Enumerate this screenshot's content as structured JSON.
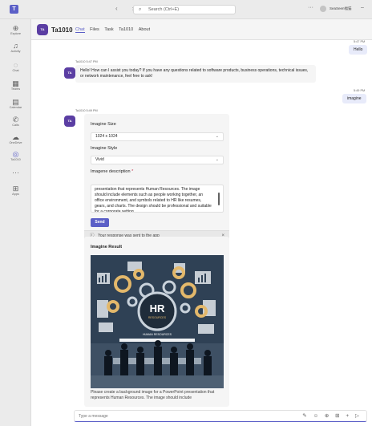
{
  "titlebar": {
    "logo": "T",
    "nav": "‹ ›",
    "search_placeholder": "Search (Ctrl+E)",
    "more": "···",
    "user": "SeaSeen福猫"
  },
  "rail": [
    {
      "label": "Explore",
      "glyph": "⊕"
    },
    {
      "label": "Activity",
      "glyph": "🔔"
    },
    {
      "label": "Chat",
      "glyph": "💬"
    },
    {
      "label": "Teams",
      "glyph": "▦"
    },
    {
      "label": "Calendar",
      "glyph": "▤"
    },
    {
      "label": "Calls",
      "glyph": "✆"
    },
    {
      "label": "OneDrive",
      "glyph": "☁"
    },
    {
      "label": "Ta1010",
      "glyph": "◎"
    },
    {
      "label": "",
      "glyph": "···"
    },
    {
      "label": "Apps",
      "glyph": "⊞"
    }
  ],
  "header": {
    "avatar_text": "TA",
    "app_name": "Ta1010",
    "tabs": [
      "Chat",
      "Files",
      "Task",
      "Ta1010",
      "About"
    ]
  },
  "messages": {
    "out1": {
      "time": "5:47 PM",
      "text": "Hello"
    },
    "in1": {
      "meta": "Ta1010  5:47 PM",
      "text": "Hello! How can I assist you today? If you have any questions related to software products, business operations, technical issues, or network maintenance, feel free to ask!"
    },
    "out2": {
      "time": "5:49 PM",
      "text": "imagine"
    },
    "in2_meta": "Ta1010  5:49 PM"
  },
  "form": {
    "size_label": "Imagine Size",
    "size_value": "1024 x 1024",
    "style_label": "Imagine Style",
    "style_value": "Vivid",
    "desc_label": "Imagene description",
    "desc_required": "*",
    "desc_text": "presentation that represents Human Resources. The image should include elements such as people working together, an office environment, and symbols related to HR like resumes, gears, and charts. The design should be professional and suitable for a corporate setting.",
    "send_label": "Send",
    "notice": "Your response was sent to the app"
  },
  "result": {
    "title": "Imagine Result",
    "image_caption_main": "HR",
    "image_caption_sub": "RESOURCES",
    "image_caption_small": "HUMAN RESOURCES",
    "desc": "Please create a background image for a PowerPoint presentation that represents Human Resources. The image should include"
  },
  "compose": {
    "placeholder": "Type a message",
    "icons": "✎ ☺ ⊕ ⊞ + ▷"
  },
  "colors": {
    "accent": "#5b5fc7",
    "rail_bg": "#ebebeb",
    "bot_avatar": "#5b3ea3",
    "bubble_out": "#e8ebfa"
  }
}
